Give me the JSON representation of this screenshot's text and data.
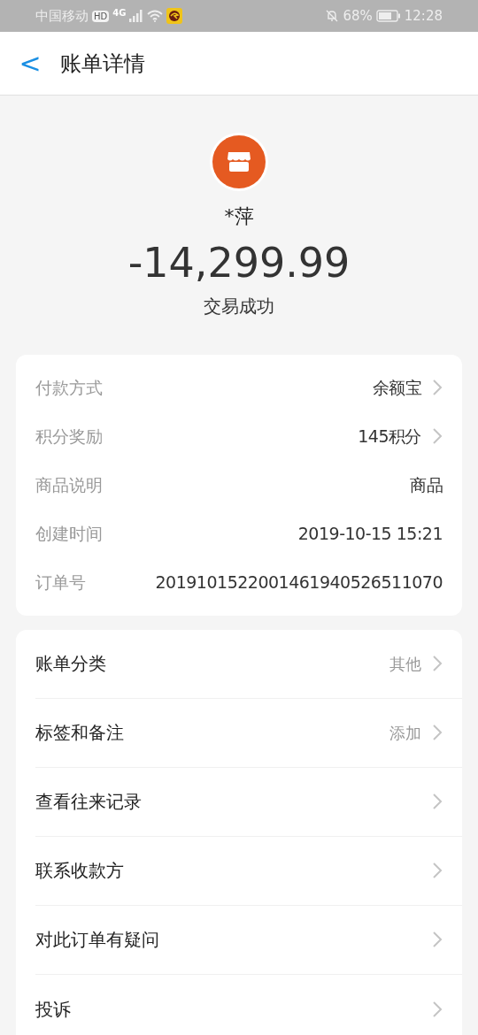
{
  "status_bar": {
    "carrier": "中国移动",
    "hd": "HD",
    "network": "4G",
    "battery_percent": "68%",
    "time": "12:28"
  },
  "header": {
    "back": "<",
    "title": "账单详情"
  },
  "summary": {
    "merchant": "*萍",
    "amount": "-14,299.99",
    "status": "交易成功"
  },
  "details": [
    {
      "label": "付款方式",
      "value": "余额宝",
      "kind": "link"
    },
    {
      "label": "积分奖励",
      "value": "145积分",
      "kind": "link"
    },
    {
      "label": "商品说明",
      "value": "商品",
      "kind": "plain"
    },
    {
      "label": "创建时间",
      "value": "2019-10-15 15:21",
      "kind": "plain"
    },
    {
      "label": "订单号",
      "value": "2019101522001461940526511070",
      "kind": "plain"
    }
  ],
  "actions": [
    {
      "label": "账单分类",
      "value": "其他"
    },
    {
      "label": "标签和备注",
      "value": "添加"
    },
    {
      "label": "查看往来记录"
    },
    {
      "label": "联系收款方"
    },
    {
      "label": "对此订单有疑问"
    },
    {
      "label": "投诉"
    }
  ]
}
